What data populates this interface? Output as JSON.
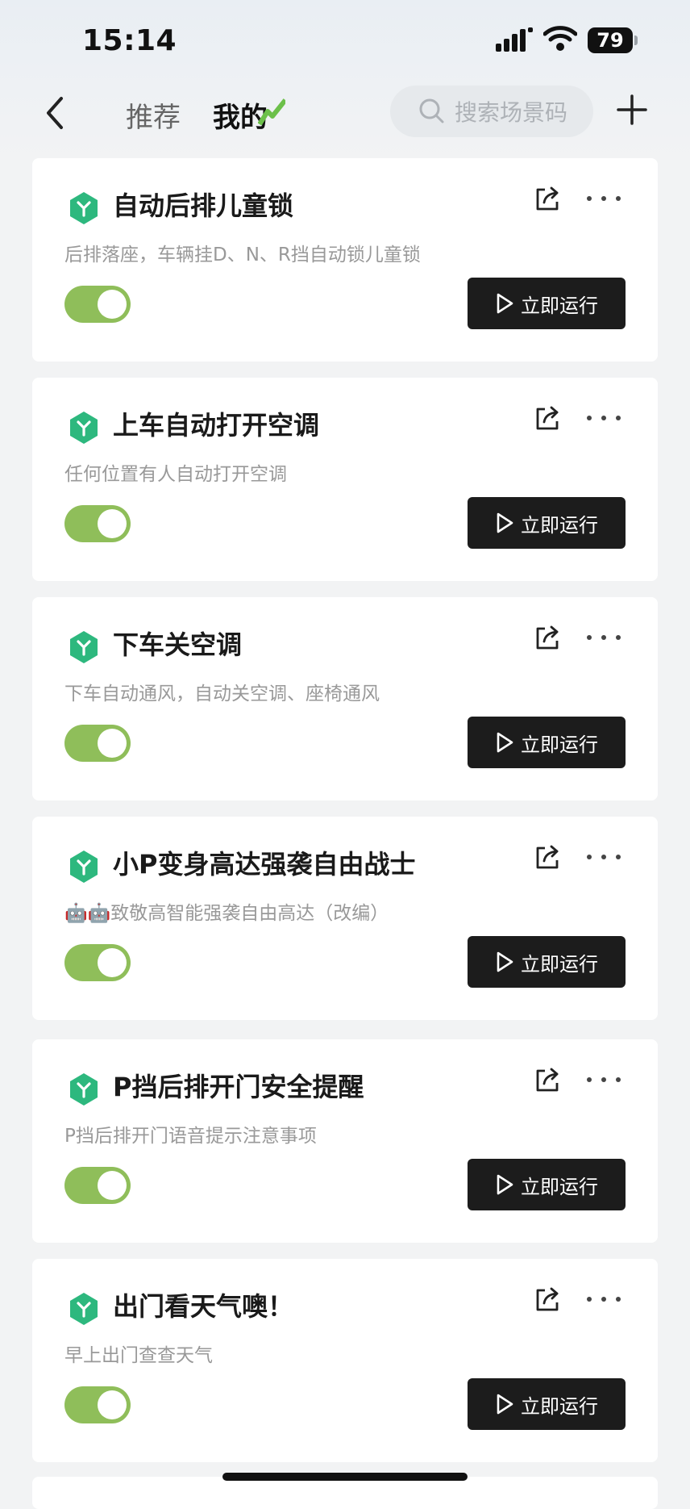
{
  "status": {
    "time": "15:14",
    "battery": "79"
  },
  "nav": {
    "tab_recommended": "推荐",
    "tab_mine": "我的",
    "search_placeholder": "搜索场景码"
  },
  "scenes": [
    {
      "title": "自动后排儿童锁",
      "desc": "后排落座，车辆挂D、N、R挡自动锁儿童锁",
      "enabled": true,
      "run_label": "立即运行"
    },
    {
      "title": "上车自动打开空调",
      "desc": "任何位置有人自动打开空调",
      "enabled": true,
      "run_label": "立即运行"
    },
    {
      "title": "下车关空调",
      "desc": "下车自动通风，自动关空调、座椅通风",
      "enabled": true,
      "run_label": "立即运行"
    },
    {
      "title": "小P变身高达强袭自由战士",
      "desc": "🤖🤖致敬高智能强袭自由高达（改编）",
      "enabled": true,
      "run_label": "立即运行"
    },
    {
      "title": "P挡后排开门安全提醒",
      "desc": "P挡后排开门语音提示注意事项",
      "enabled": true,
      "run_label": "立即运行"
    },
    {
      "title": "出门看天气噢！",
      "desc": "早上出门查查天气",
      "enabled": true,
      "run_label": "立即运行"
    }
  ],
  "colors": {
    "toggle_on": "#8fbe5a",
    "badge": "#2db87e",
    "run_button": "#1c1c1c",
    "tab_mark": "#6cc04a"
  },
  "icons": {
    "back": "chevron-left-icon",
    "search": "search-icon",
    "add": "plus-icon",
    "badge": "scene-hex-icon",
    "share": "share-icon",
    "more": "more-dots-icon",
    "play": "play-icon"
  }
}
